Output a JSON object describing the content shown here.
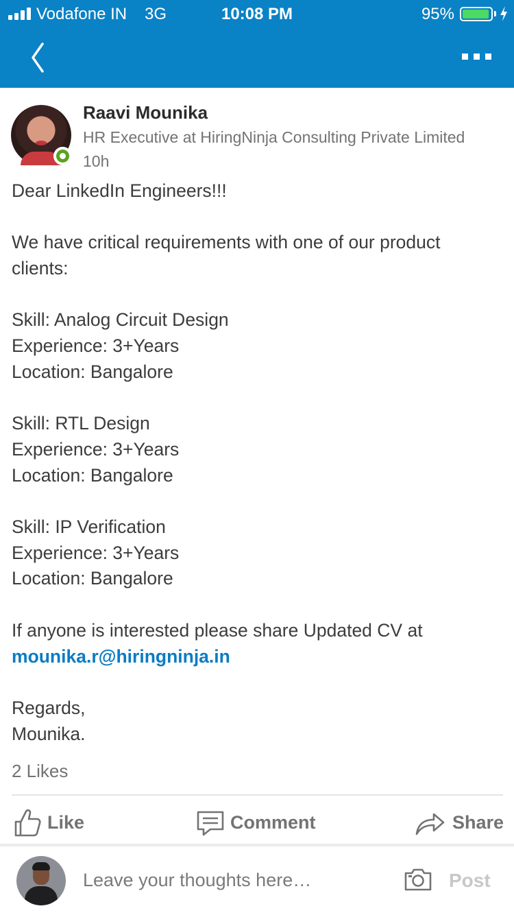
{
  "status_bar": {
    "carrier": "Vodafone IN",
    "network": "3G",
    "time": "10:08 PM",
    "battery_percent": "95%",
    "battery_level": 0.95,
    "signal_bars": 4
  },
  "nav": {
    "back_icon": "chevron-left-icon",
    "more_icon": "more-dots-icon",
    "background_color": "#0a82c6"
  },
  "post": {
    "author_name": "Raavi Mounika",
    "author_headline": "HR Executive at HiringNinja Consulting Private Limited",
    "timestamp": "10h",
    "online": true,
    "body": {
      "greeting": "Dear LinkedIn Engineers!!!",
      "intro_line1": "We have critical requirements with one of our product",
      "intro_line2": "clients:",
      "requirements": [
        {
          "skill": "Skill: Analog Circuit Design",
          "experience": "Experience: 3+Years",
          "location": "Location: Bangalore"
        },
        {
          "skill": "Skill: RTL Design",
          "experience": "Experience: 3+Years",
          "location": "Location: Bangalore"
        },
        {
          "skill": "Skill: IP Verification",
          "experience": "Experience: 3+Years",
          "location": "Location: Bangalore"
        }
      ],
      "cta": "If anyone is interested please share Updated CV at",
      "email": "mounika.r@hiringninja.in",
      "regards": "Regards,",
      "signature": "Mounika."
    },
    "likes_count": "2 Likes"
  },
  "actions": {
    "like_label": "Like",
    "comment_label": "Comment",
    "share_label": "Share"
  },
  "composer": {
    "placeholder": "Leave your thoughts here…",
    "post_label": "Post",
    "camera_icon": "camera-icon"
  },
  "colors": {
    "accent": "#0a82c6",
    "link": "#0a7cc4",
    "online": "#5aa31f",
    "battery": "#4cd964"
  }
}
